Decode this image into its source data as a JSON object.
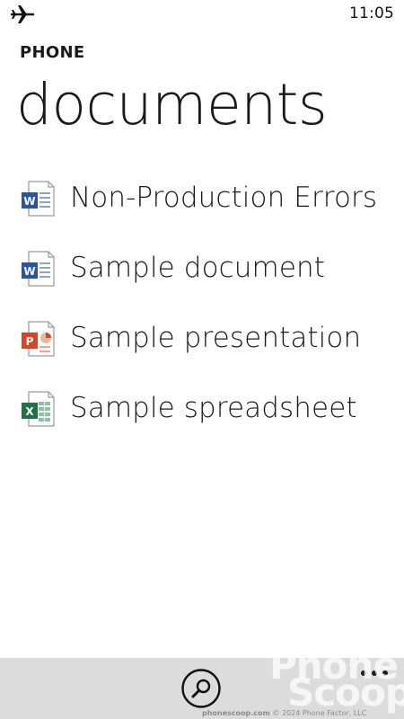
{
  "status_bar": {
    "icon": "airplane-icon",
    "time": "11:05"
  },
  "header": {
    "app_title": "PHONE",
    "page_title": "documents"
  },
  "documents": [
    {
      "label": "Non-Production Errors",
      "icon": "word-doc-icon",
      "color": "#2b579a"
    },
    {
      "label": "Sample document",
      "icon": "word-doc-icon",
      "color": "#2b579a"
    },
    {
      "label": "Sample presentation",
      "icon": "powerpoint-doc-icon",
      "color": "#d24726"
    },
    {
      "label": "Sample spreadsheet",
      "icon": "excel-doc-icon",
      "color": "#217346"
    }
  ],
  "app_bar": {
    "search_icon": "search-icon",
    "more_icon": "more-icon",
    "background": "#dcdcdc"
  },
  "watermark": {
    "line1": "Phone",
    "line2": "Scoop",
    "site": "phonescoop.com",
    "copyright": "© 2024 Phone Factor, LLC"
  }
}
